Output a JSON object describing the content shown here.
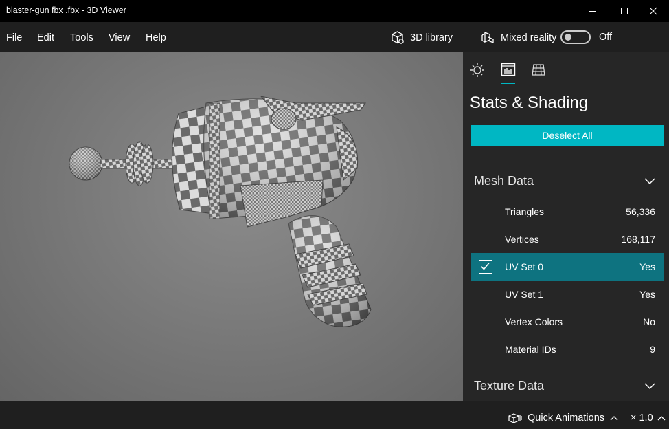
{
  "window": {
    "title": "blaster-gun fbx .fbx - 3D Viewer"
  },
  "menu": {
    "file": "File",
    "edit": "Edit",
    "tools": "Tools",
    "view": "View",
    "help": "Help"
  },
  "toolbar": {
    "library": "3D library",
    "mixed_reality": "Mixed reality",
    "toggle_state": "Off"
  },
  "panel": {
    "title": "Stats & Shading",
    "deselect_label": "Deselect All",
    "mesh_section": "Mesh Data",
    "texture_section": "Texture Data",
    "rows": [
      {
        "label": "Triangles",
        "value": "56,336"
      },
      {
        "label": "Vertices",
        "value": "168,117"
      },
      {
        "label": "UV Set 0",
        "value": "Yes"
      },
      {
        "label": "UV Set 1",
        "value": "Yes"
      },
      {
        "label": "Vertex Colors",
        "value": "No"
      },
      {
        "label": "Material IDs",
        "value": "9"
      }
    ]
  },
  "status": {
    "animations": "Quick Animations",
    "speed": "× 1.0"
  },
  "colors": {
    "accent": "#00b7c3",
    "selected_row": "#0e7380",
    "panel_bg": "#262626",
    "chrome_bg": "#1f1f1f"
  }
}
